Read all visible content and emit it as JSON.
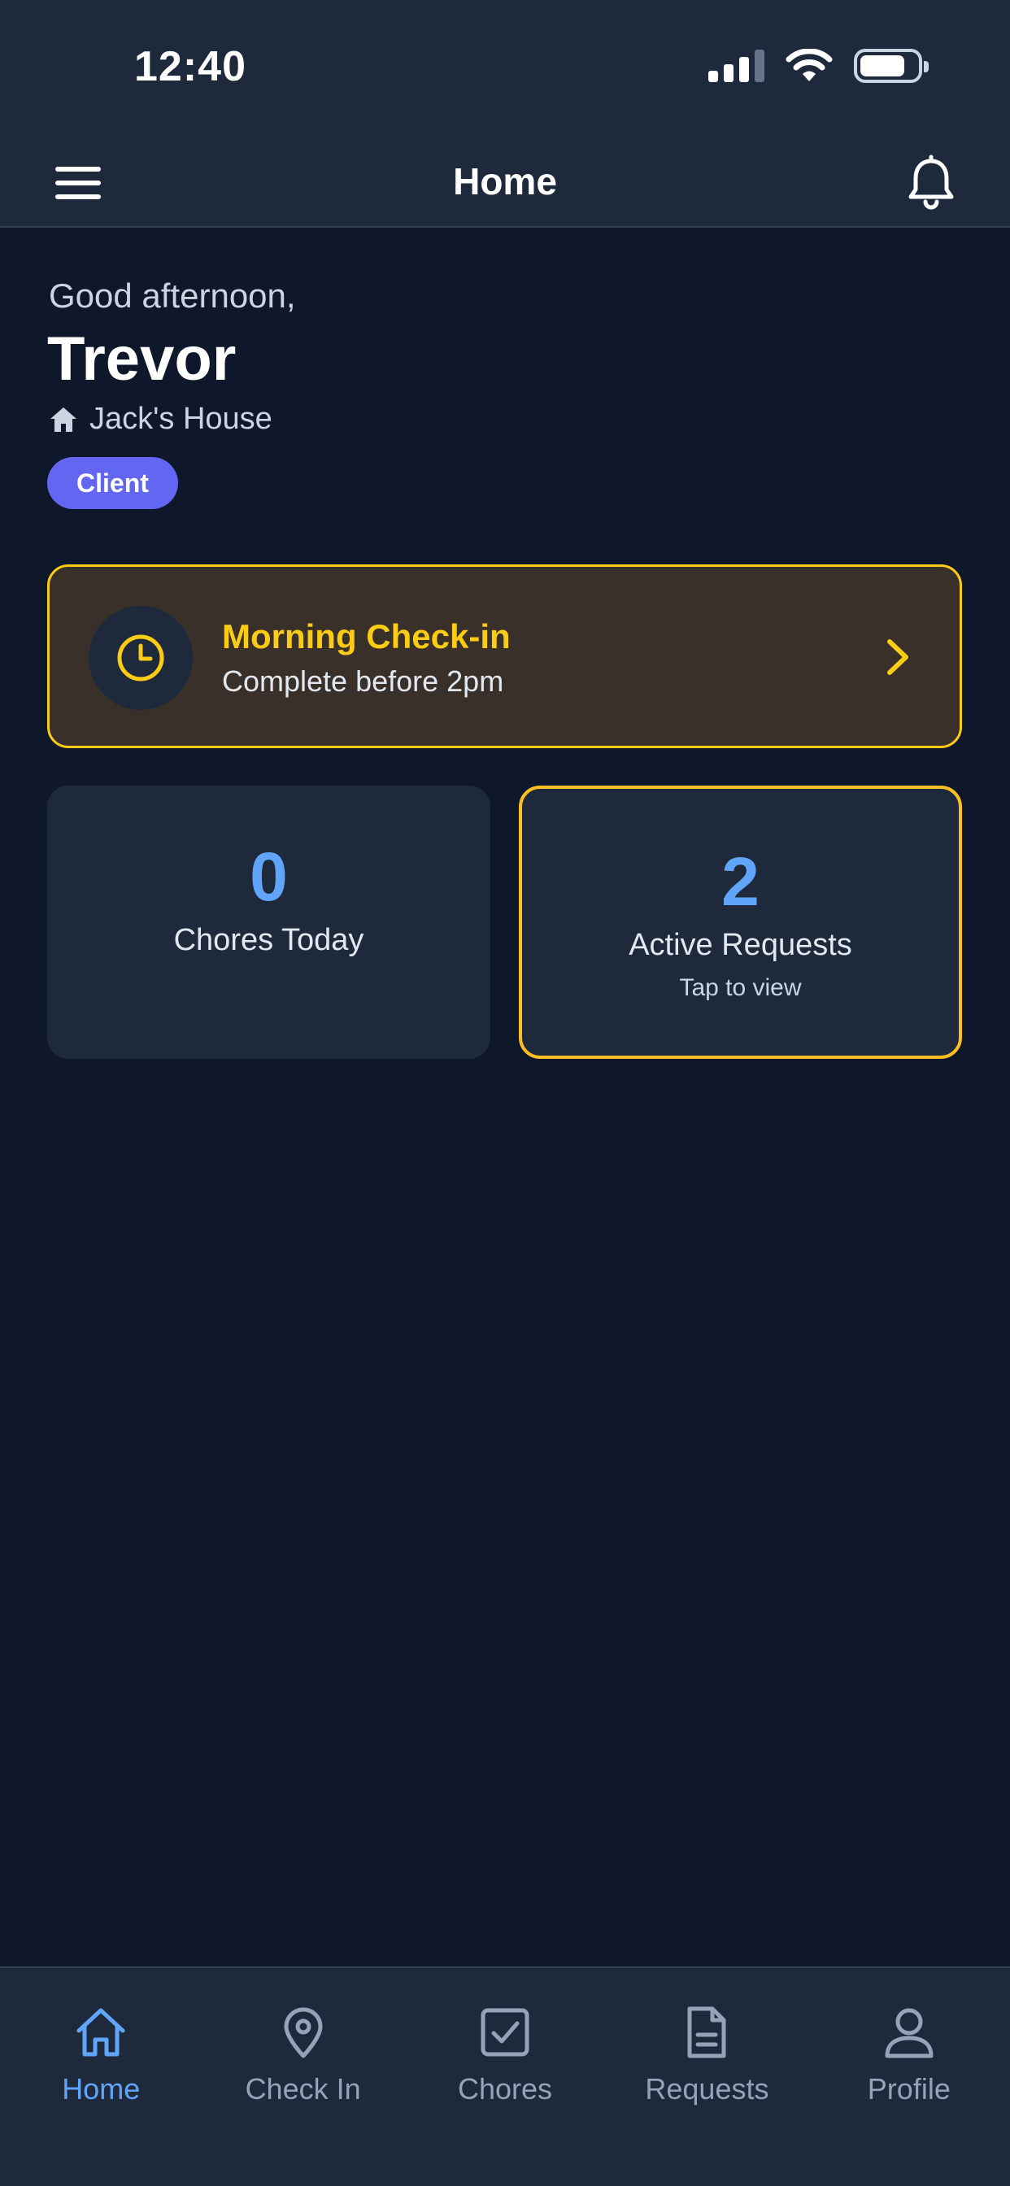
{
  "status_bar": {
    "time": "12:40",
    "battery_level": 0.8
  },
  "header": {
    "title": "Home",
    "menu_icon": "hamburger-menu-icon",
    "notifications_icon": "bell-icon"
  },
  "greeting": {
    "salutation": "Good afternoon,",
    "name": "Trevor",
    "house_icon": "house-icon",
    "house": "Jack's House",
    "role": "Client"
  },
  "checkin": {
    "icon": "clock-icon",
    "title": "Morning Check-in",
    "subtitle": "Complete before 2pm"
  },
  "stats": {
    "chores": {
      "value": "0",
      "label": "Chores Today"
    },
    "requests": {
      "value": "2",
      "label": "Active Requests",
      "hint": "Tap to view"
    }
  },
  "nav": [
    {
      "label": "Home",
      "icon": "home-icon"
    },
    {
      "label": "Check In",
      "icon": "map-pin-icon"
    },
    {
      "label": "Chores",
      "icon": "checkbox-icon"
    },
    {
      "label": "Requests",
      "icon": "document-icon"
    },
    {
      "label": "Profile",
      "icon": "user-icon"
    }
  ],
  "colors": {
    "background": "#0f172a",
    "surface": "#1e293b",
    "accent_blue": "#60a5fa",
    "accent_yellow": "#facc15",
    "badge_purple": "#6366f1"
  }
}
